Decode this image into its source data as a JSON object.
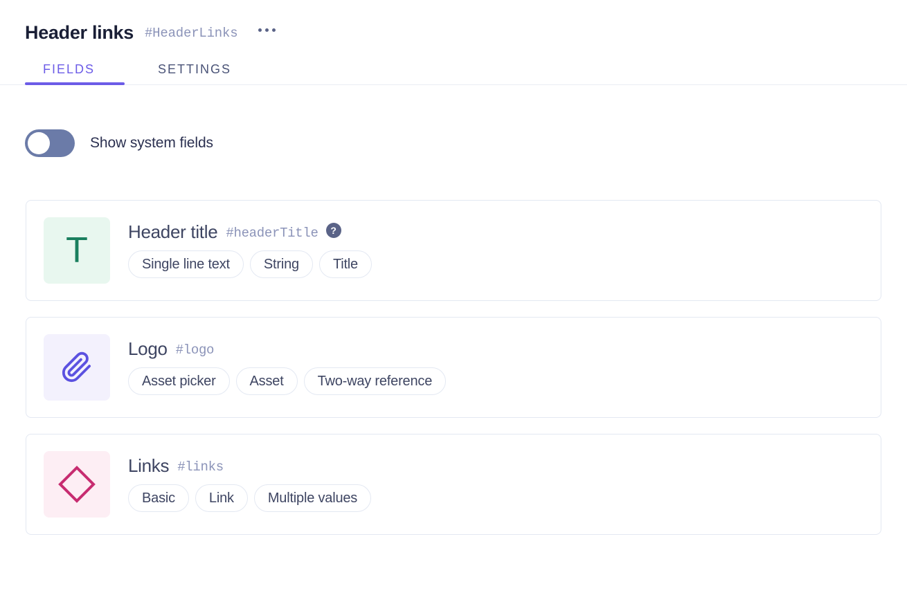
{
  "header": {
    "title": "Header links",
    "hash": "#HeaderLinks",
    "menu_icon": "ellipsis-icon"
  },
  "tabs": [
    {
      "label": "FIELDS",
      "active": true
    },
    {
      "label": "SETTINGS",
      "active": false
    }
  ],
  "toggle": {
    "label": "Show system fields",
    "state": "off",
    "track_color": "#6b7ba8",
    "knob_color": "#ffffff"
  },
  "fields": [
    {
      "title": "Header title",
      "hash": "#headerTitle",
      "help": "?",
      "has_help": true,
      "icon": "text-icon",
      "icon_glyph": "T",
      "icon_bg": "#e8f7ef",
      "icon_fg": "#1a7f5e",
      "pills": [
        "Single line text",
        "String",
        "Title"
      ]
    },
    {
      "title": "Logo",
      "hash": "#logo",
      "has_help": false,
      "icon": "paperclip-icon",
      "icon_bg": "#f3f1fd",
      "icon_fg": "#5b51e0",
      "pills": [
        "Asset picker",
        "Asset",
        "Two-way reference"
      ]
    },
    {
      "title": "Links",
      "hash": "#links",
      "has_help": false,
      "icon": "diamond-icon",
      "icon_bg": "#fdeef4",
      "icon_fg": "#c72c70",
      "pills": [
        "Basic",
        "Link",
        "Multiple values"
      ]
    }
  ],
  "colors": {
    "accent": "#6c5ce7",
    "title": "#1a1f36",
    "hash": "#8b93b8",
    "border": "#e3e8f2",
    "text": "#3e4562"
  }
}
